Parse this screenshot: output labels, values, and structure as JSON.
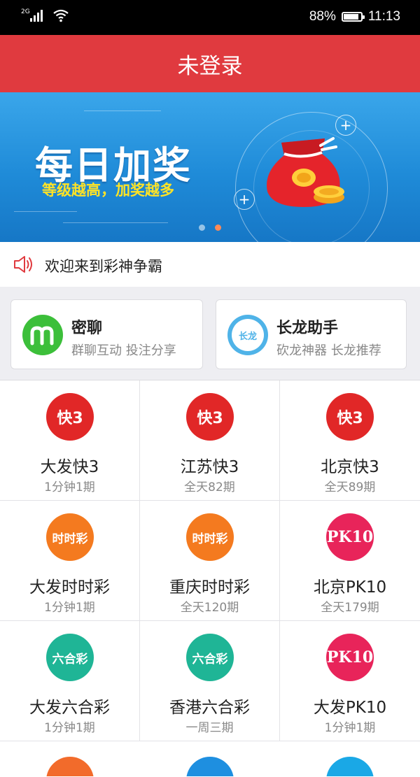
{
  "status_bar": {
    "network": "2G",
    "battery_percent": "88%",
    "battery_level": 0.88,
    "time": "11:13"
  },
  "header": {
    "title": "未登录"
  },
  "banner": {
    "title": "每日加奖",
    "subtitle": "等级越高，加奖越多",
    "active_slide": 2,
    "slide_count": 2
  },
  "notice": {
    "icon": "speaker-icon",
    "text": "欢迎来到彩神争霸"
  },
  "features": [
    {
      "title": "密聊",
      "subtitle": "群聊互动 投注分享",
      "icon": "m-chat-icon",
      "icon_letter": "m",
      "color": "#3cbf3a"
    },
    {
      "title": "长龙助手",
      "subtitle": "砍龙神器 长龙推荐",
      "icon": "dragon-icon",
      "icon_letter": "长龙",
      "color": "#4fb3e8"
    }
  ],
  "games": [
    {
      "name": "大发快3",
      "freq": "1分钟1期",
      "icon": "kuai3-icon",
      "logo": "快3",
      "color": "#e12727"
    },
    {
      "name": "江苏快3",
      "freq": "全天82期",
      "icon": "kuai3-icon",
      "logo": "快3",
      "color": "#e12727"
    },
    {
      "name": "北京快3",
      "freq": "全天89期",
      "icon": "kuai3-icon",
      "logo": "快3",
      "color": "#e12727"
    },
    {
      "name": "大发时时彩",
      "freq": "1分钟1期",
      "icon": "shishicai-icon",
      "logo": "时时彩",
      "color": "#f47a1f"
    },
    {
      "name": "重庆时时彩",
      "freq": "全天120期",
      "icon": "shishicai-icon",
      "logo": "时时彩",
      "color": "#f47a1f"
    },
    {
      "name": "北京PK10",
      "freq": "全天179期",
      "icon": "pk10-icon",
      "logo": "PK10",
      "color": "#e8245a"
    },
    {
      "name": "大发六合彩",
      "freq": "1分钟1期",
      "icon": "liuhecai-icon",
      "logo": "六合彩",
      "color": "#1fb596"
    },
    {
      "name": "香港六合彩",
      "freq": "一周三期",
      "icon": "liuhecai-icon",
      "logo": "六合彩",
      "color": "#1fb596"
    },
    {
      "name": "大发PK10",
      "freq": "1分钟1期",
      "icon": "pk10-icon",
      "logo": "PK10",
      "color": "#e8245a"
    }
  ],
  "partial_icons": [
    {
      "icon": "partial-lottery-icon-1",
      "color": "#f26b2b"
    },
    {
      "icon": "partial-lottery-icon-2",
      "color": "#1e8fe0"
    },
    {
      "icon": "partial-lottery-icon-3",
      "color": "#1aa8e6"
    }
  ]
}
